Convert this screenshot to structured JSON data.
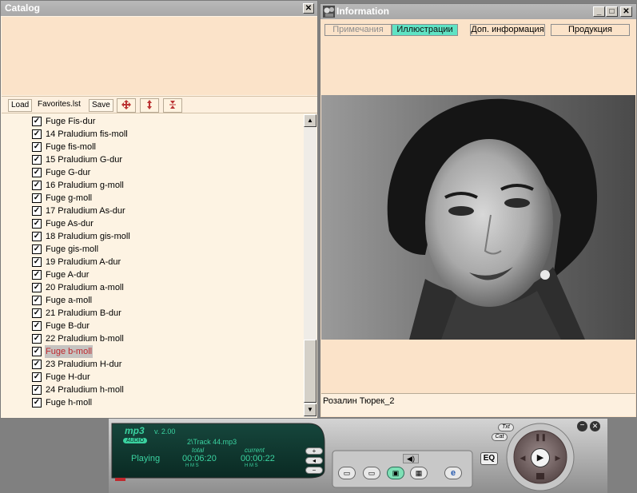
{
  "catalog": {
    "title": "Catalog",
    "close_glyph": "✕",
    "toolbar": {
      "load_label": "Load",
      "favorites_label": "Favorites.lst",
      "save_label": "Save",
      "move_icon": "four-way-arrow-icon",
      "up_down_icon": "up-down-arrow-icon",
      "collapse_icon": "collapse-arrow-icon"
    },
    "tracks": [
      {
        "label": "Fuge Fis-dur",
        "checked": true
      },
      {
        "label": "14 Praludium fis-moll",
        "checked": true
      },
      {
        "label": "Fuge fis-moll",
        "checked": true
      },
      {
        "label": "15 Praludium G-dur",
        "checked": true
      },
      {
        "label": "Fuge G-dur",
        "checked": true
      },
      {
        "label": "16 Praludium g-moll",
        "checked": true
      },
      {
        "label": "Fuge g-moll",
        "checked": true
      },
      {
        "label": "17 Praludium As-dur",
        "checked": true
      },
      {
        "label": "Fuge As-dur",
        "checked": true
      },
      {
        "label": "18 Praludium gis-moll",
        "checked": true
      },
      {
        "label": "Fuge gis-moll",
        "checked": true
      },
      {
        "label": "19 Praludium A-dur",
        "checked": true
      },
      {
        "label": "Fuge A-dur",
        "checked": true
      },
      {
        "label": "20 Praludium a-moll",
        "checked": true
      },
      {
        "label": "Fuge a-moll",
        "checked": true
      },
      {
        "label": "21 Praludium B-dur",
        "checked": true
      },
      {
        "label": "Fuge B-dur",
        "checked": true
      },
      {
        "label": "22 Praludium b-moll",
        "checked": true
      },
      {
        "label": "Fuge b-moll",
        "checked": true,
        "selected": true
      },
      {
        "label": "23 Praludium H-dur",
        "checked": true
      },
      {
        "label": "Fuge H-dur",
        "checked": true
      },
      {
        "label": "24 Praludium h-moll",
        "checked": true
      },
      {
        "label": "Fuge h-moll",
        "checked": true
      }
    ]
  },
  "info": {
    "title": "Information",
    "tabs": [
      {
        "label": "Примечания",
        "state": "dim"
      },
      {
        "label": "Иллюстрации",
        "state": "active"
      },
      {
        "label": "Доп. информация",
        "state": "normal"
      },
      {
        "label": "Продукция",
        "state": "normal"
      }
    ],
    "caption": "Розалин Тюрек_2"
  },
  "player": {
    "logo": "mp3",
    "version": "v. 2.00",
    "mode_badge": "AUDIO",
    "track": "2\\Track 44.mp3",
    "status": "Playing",
    "total_label": "total",
    "current_label": "current",
    "total_time": "00:06:20",
    "current_time": "00:00:22",
    "units_total": "H  M  S",
    "units_current": "H  M  S",
    "eq_label": "EQ",
    "txt_label": "Txt",
    "cat_label": "Cat",
    "progress": 0.05,
    "colors": {
      "display_bg": "#0c3b32",
      "display_text": "#3ad2a0",
      "accent": "#c0282d"
    }
  }
}
